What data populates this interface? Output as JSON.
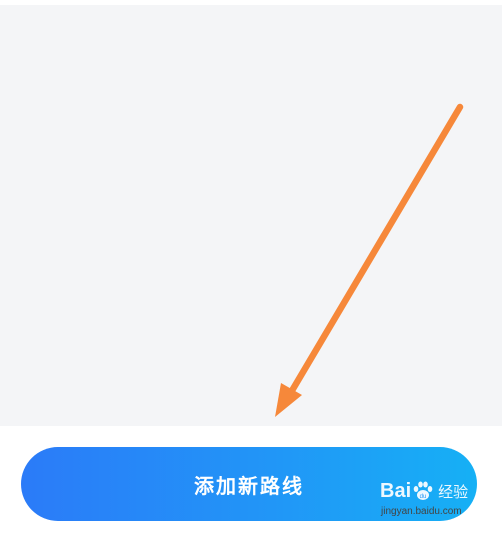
{
  "screen": {
    "background_color": "#f4f5f7",
    "accent_arrow_color": "#f6883a"
  },
  "bottom_bar": {
    "add_route_label": "添加新路线",
    "button_gradient": [
      "#2b7bf8",
      "#16b0f5"
    ]
  },
  "watermark": {
    "brand_prefix": "Bai",
    "brand_suffix": "du",
    "product": "经验",
    "url": "jingyan.baidu.com"
  }
}
